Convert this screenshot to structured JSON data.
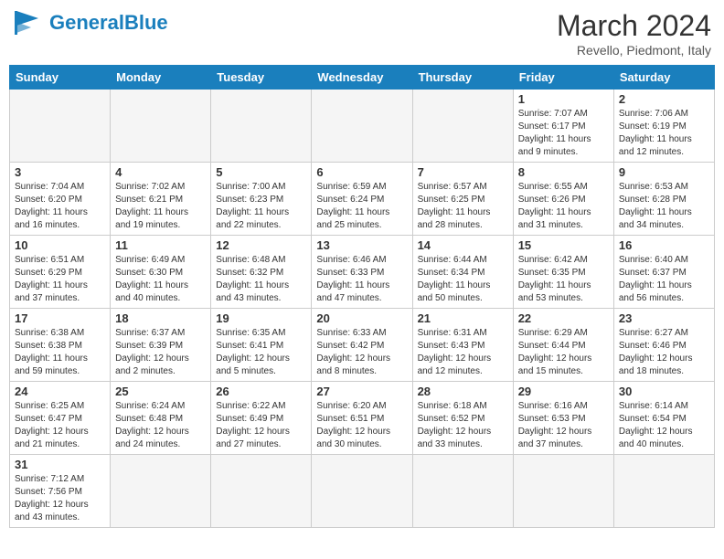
{
  "header": {
    "logo_general": "General",
    "logo_blue": "Blue",
    "month_title": "March 2024",
    "subtitle": "Revello, Piedmont, Italy"
  },
  "weekdays": [
    "Sunday",
    "Monday",
    "Tuesday",
    "Wednesday",
    "Thursday",
    "Friday",
    "Saturday"
  ],
  "weeks": [
    [
      {
        "day": "",
        "info": ""
      },
      {
        "day": "",
        "info": ""
      },
      {
        "day": "",
        "info": ""
      },
      {
        "day": "",
        "info": ""
      },
      {
        "day": "",
        "info": ""
      },
      {
        "day": "1",
        "info": "Sunrise: 7:07 AM\nSunset: 6:17 PM\nDaylight: 11 hours\nand 9 minutes."
      },
      {
        "day": "2",
        "info": "Sunrise: 7:06 AM\nSunset: 6:19 PM\nDaylight: 11 hours\nand 12 minutes."
      }
    ],
    [
      {
        "day": "3",
        "info": "Sunrise: 7:04 AM\nSunset: 6:20 PM\nDaylight: 11 hours\nand 16 minutes."
      },
      {
        "day": "4",
        "info": "Sunrise: 7:02 AM\nSunset: 6:21 PM\nDaylight: 11 hours\nand 19 minutes."
      },
      {
        "day": "5",
        "info": "Sunrise: 7:00 AM\nSunset: 6:23 PM\nDaylight: 11 hours\nand 22 minutes."
      },
      {
        "day": "6",
        "info": "Sunrise: 6:59 AM\nSunset: 6:24 PM\nDaylight: 11 hours\nand 25 minutes."
      },
      {
        "day": "7",
        "info": "Sunrise: 6:57 AM\nSunset: 6:25 PM\nDaylight: 11 hours\nand 28 minutes."
      },
      {
        "day": "8",
        "info": "Sunrise: 6:55 AM\nSunset: 6:26 PM\nDaylight: 11 hours\nand 31 minutes."
      },
      {
        "day": "9",
        "info": "Sunrise: 6:53 AM\nSunset: 6:28 PM\nDaylight: 11 hours\nand 34 minutes."
      }
    ],
    [
      {
        "day": "10",
        "info": "Sunrise: 6:51 AM\nSunset: 6:29 PM\nDaylight: 11 hours\nand 37 minutes."
      },
      {
        "day": "11",
        "info": "Sunrise: 6:49 AM\nSunset: 6:30 PM\nDaylight: 11 hours\nand 40 minutes."
      },
      {
        "day": "12",
        "info": "Sunrise: 6:48 AM\nSunset: 6:32 PM\nDaylight: 11 hours\nand 43 minutes."
      },
      {
        "day": "13",
        "info": "Sunrise: 6:46 AM\nSunset: 6:33 PM\nDaylight: 11 hours\nand 47 minutes."
      },
      {
        "day": "14",
        "info": "Sunrise: 6:44 AM\nSunset: 6:34 PM\nDaylight: 11 hours\nand 50 minutes."
      },
      {
        "day": "15",
        "info": "Sunrise: 6:42 AM\nSunset: 6:35 PM\nDaylight: 11 hours\nand 53 minutes."
      },
      {
        "day": "16",
        "info": "Sunrise: 6:40 AM\nSunset: 6:37 PM\nDaylight: 11 hours\nand 56 minutes."
      }
    ],
    [
      {
        "day": "17",
        "info": "Sunrise: 6:38 AM\nSunset: 6:38 PM\nDaylight: 11 hours\nand 59 minutes."
      },
      {
        "day": "18",
        "info": "Sunrise: 6:37 AM\nSunset: 6:39 PM\nDaylight: 12 hours\nand 2 minutes."
      },
      {
        "day": "19",
        "info": "Sunrise: 6:35 AM\nSunset: 6:41 PM\nDaylight: 12 hours\nand 5 minutes."
      },
      {
        "day": "20",
        "info": "Sunrise: 6:33 AM\nSunset: 6:42 PM\nDaylight: 12 hours\nand 8 minutes."
      },
      {
        "day": "21",
        "info": "Sunrise: 6:31 AM\nSunset: 6:43 PM\nDaylight: 12 hours\nand 12 minutes."
      },
      {
        "day": "22",
        "info": "Sunrise: 6:29 AM\nSunset: 6:44 PM\nDaylight: 12 hours\nand 15 minutes."
      },
      {
        "day": "23",
        "info": "Sunrise: 6:27 AM\nSunset: 6:46 PM\nDaylight: 12 hours\nand 18 minutes."
      }
    ],
    [
      {
        "day": "24",
        "info": "Sunrise: 6:25 AM\nSunset: 6:47 PM\nDaylight: 12 hours\nand 21 minutes."
      },
      {
        "day": "25",
        "info": "Sunrise: 6:24 AM\nSunset: 6:48 PM\nDaylight: 12 hours\nand 24 minutes."
      },
      {
        "day": "26",
        "info": "Sunrise: 6:22 AM\nSunset: 6:49 PM\nDaylight: 12 hours\nand 27 minutes."
      },
      {
        "day": "27",
        "info": "Sunrise: 6:20 AM\nSunset: 6:51 PM\nDaylight: 12 hours\nand 30 minutes."
      },
      {
        "day": "28",
        "info": "Sunrise: 6:18 AM\nSunset: 6:52 PM\nDaylight: 12 hours\nand 33 minutes."
      },
      {
        "day": "29",
        "info": "Sunrise: 6:16 AM\nSunset: 6:53 PM\nDaylight: 12 hours\nand 37 minutes."
      },
      {
        "day": "30",
        "info": "Sunrise: 6:14 AM\nSunset: 6:54 PM\nDaylight: 12 hours\nand 40 minutes."
      }
    ],
    [
      {
        "day": "31",
        "info": "Sunrise: 7:12 AM\nSunset: 7:56 PM\nDaylight: 12 hours\nand 43 minutes."
      },
      {
        "day": "",
        "info": ""
      },
      {
        "day": "",
        "info": ""
      },
      {
        "day": "",
        "info": ""
      },
      {
        "day": "",
        "info": ""
      },
      {
        "day": "",
        "info": ""
      },
      {
        "day": "",
        "info": ""
      }
    ]
  ]
}
